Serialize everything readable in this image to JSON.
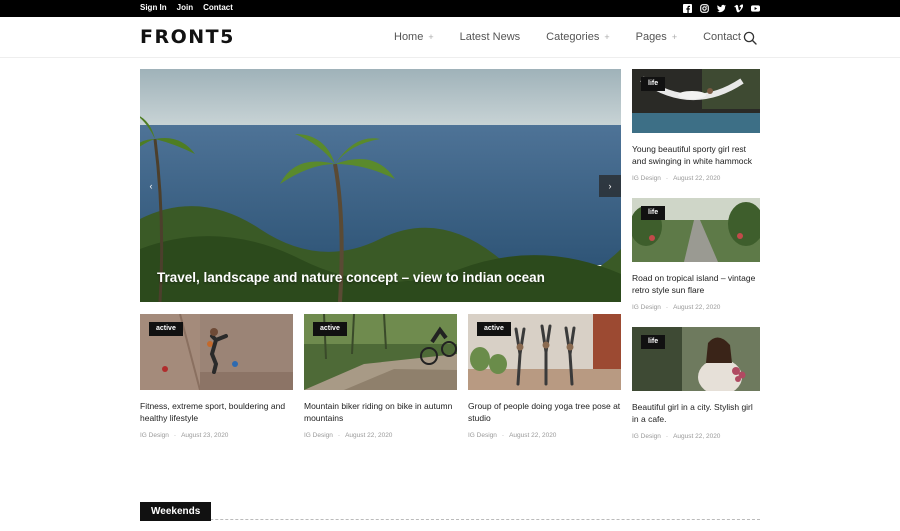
{
  "topbar": {
    "links": [
      "Sign In",
      "Join",
      "Contact"
    ],
    "social_icons": [
      "facebook-icon",
      "instagram-icon",
      "twitter-icon",
      "vimeo-icon",
      "youtube-icon"
    ]
  },
  "header": {
    "logo": "FRONT5",
    "nav": [
      {
        "label": "Home",
        "caret": "+"
      },
      {
        "label": "Latest News",
        "caret": ""
      },
      {
        "label": "Categories",
        "caret": "+"
      },
      {
        "label": "Pages",
        "caret": "+"
      },
      {
        "label": "Contact",
        "caret": ""
      }
    ],
    "search_icon": "search-icon"
  },
  "hero": {
    "title": "Travel, landscape and nature concept – view to indian ocean",
    "prev": "‹",
    "next": "›"
  },
  "cards": [
    {
      "badge": "active",
      "title": "Fitness, extreme sport, bouldering and healthy lifestyle",
      "author": "IG Design",
      "date": "August 23, 2020"
    },
    {
      "badge": "active",
      "title": "Mountain biker riding on bike in autumn mountains",
      "author": "IG Design",
      "date": "August 22, 2020"
    },
    {
      "badge": "active",
      "title": "Group of people doing yoga tree pose at studio",
      "author": "IG Design",
      "date": "August 22, 2020"
    }
  ],
  "sidebar": [
    {
      "badge": "life",
      "title": "Young beautiful sporty girl rest and swinging in white hammock",
      "author": "IG Design",
      "date": "August 22, 2020"
    },
    {
      "badge": "life",
      "title": "Road on tropical island – vintage retro style sun flare",
      "author": "IG Design",
      "date": "August 22, 2020"
    },
    {
      "badge": "life",
      "title": "Beautiful girl in a city. Stylish girl in a cafe.",
      "author": "IG Design",
      "date": "August 22, 2020"
    }
  ],
  "section": {
    "title": "Weekends"
  },
  "meta_separator": "-"
}
